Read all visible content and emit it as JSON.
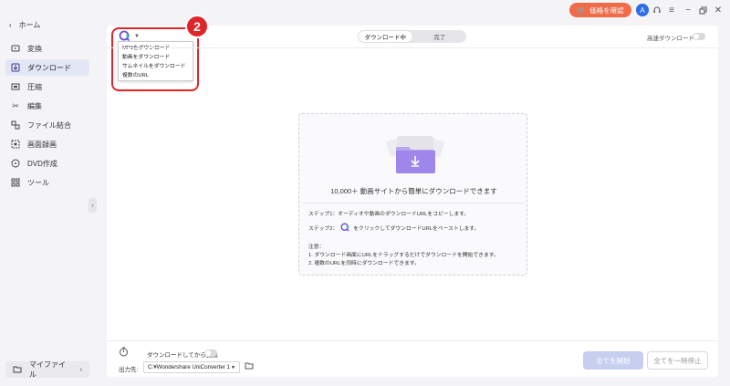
{
  "titlebar": {
    "price_button_label": "価格を確認",
    "avatar_letter": "A"
  },
  "sidebar": {
    "home_label": "ホーム",
    "items": [
      {
        "label": "変換",
        "icon": "convert-icon"
      },
      {
        "label": "ダウンロード",
        "icon": "download-icon",
        "active": true
      },
      {
        "label": "圧縮",
        "icon": "compress-icon"
      },
      {
        "label": "編集",
        "icon": "scissors-icon"
      },
      {
        "label": "ファイル結合",
        "icon": "merge-icon"
      },
      {
        "label": "画面録画",
        "icon": "screen-record-icon"
      },
      {
        "label": "DVD作成",
        "icon": "dvd-icon"
      },
      {
        "label": "ツール",
        "icon": "tools-icon"
      }
    ],
    "myfiles_label": "マイファイル"
  },
  "main": {
    "dropdown_options": [
      "MP3をダウンロード",
      "動画をダウンロード",
      "サムネイルをダウンロード",
      "複数のURL"
    ],
    "badge_number": "2",
    "tabs": [
      "ダウンロード中",
      "完了"
    ],
    "active_tab": 0,
    "highspeed_label": "高速ダウンロード",
    "card": {
      "title": "10,000＋ 動画サイトから簡単にダウンロードできます",
      "step1": "ステップ1：オーディオや動画のダウンロードURLをコピーします。",
      "step2_prefix": "ステップ2：",
      "step2_suffix": "をクリックしてダウンロードURLをペーストします。",
      "note_title": "注意：",
      "note1": "1. ダウンロード画面にURLをドラッグするだけでダウンロードを開始できます。",
      "note2": "2. 複数のURLを同時にダウンロードできます。"
    },
    "footer": {
      "convert_after_label": "ダウンロードしてから変換",
      "output_label": "出力先:",
      "output_path": "C:¥Wondershare UniConverter 1",
      "start_all_label": "全てを開始",
      "pause_all_label": "全てを一時停止"
    }
  },
  "colors": {
    "accent": "#7b6cf0",
    "highlight_red": "#e0242b",
    "price_button": "#ef6b4a"
  }
}
